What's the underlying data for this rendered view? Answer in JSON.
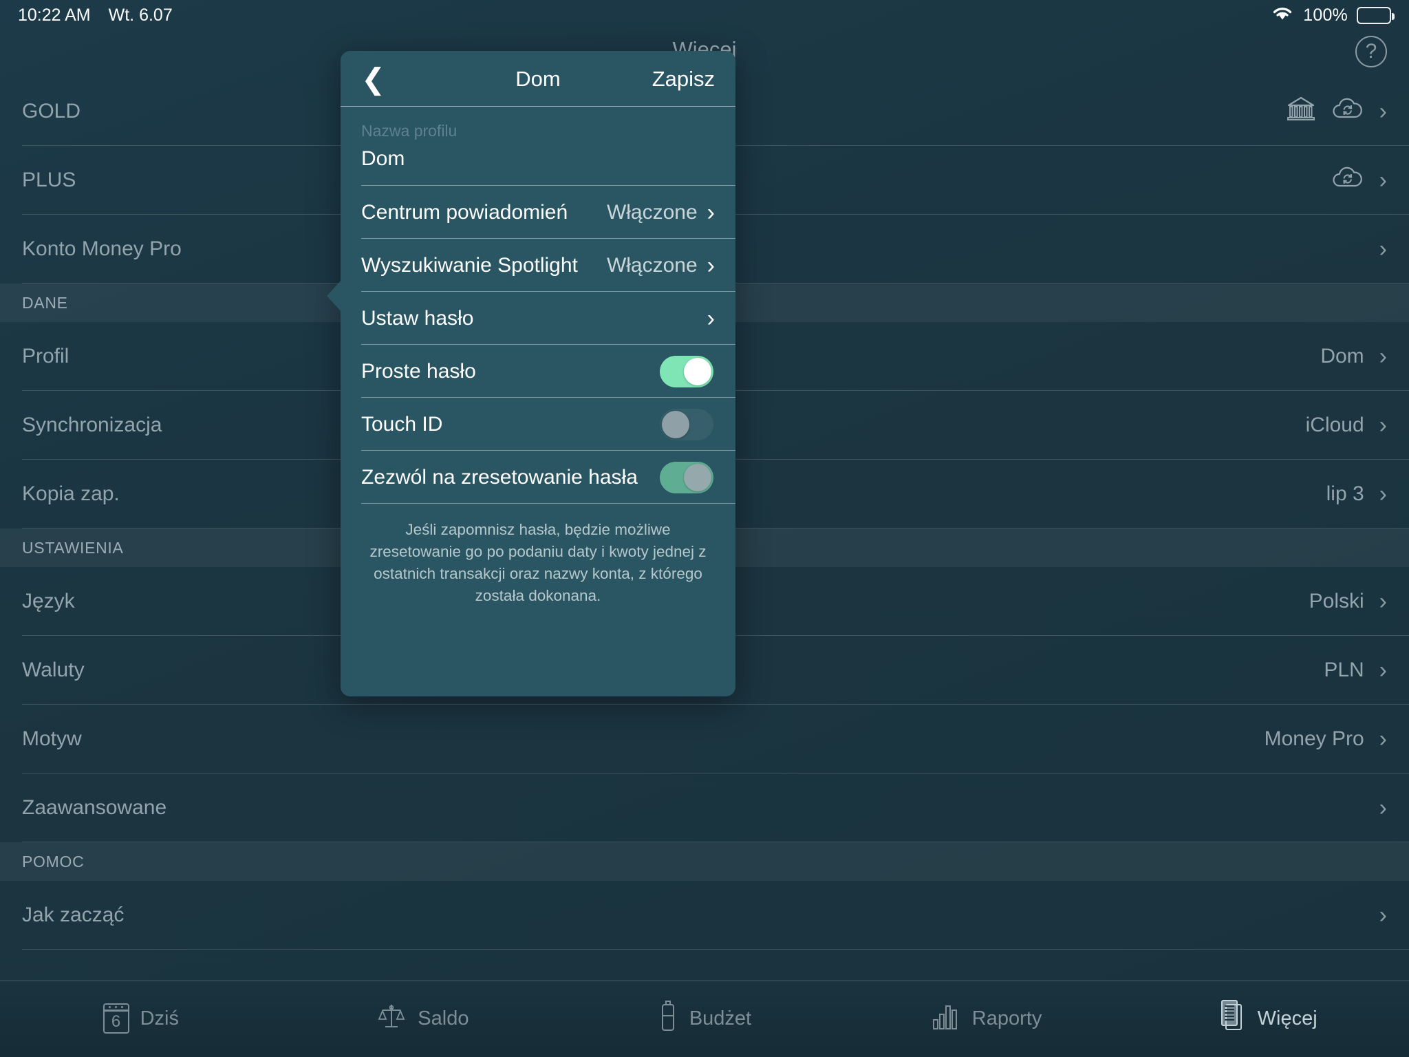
{
  "status_bar": {
    "time": "10:22 AM",
    "date": "Wt. 6.07",
    "battery_percent": "100%",
    "wifi_icon": "wifi-icon",
    "battery_icon": "battery-full-icon"
  },
  "header": {
    "title": "Więcej",
    "help_icon": "question-circle-icon",
    "help_label": "?"
  },
  "background_list": {
    "rows": [
      {
        "type": "item",
        "label": "GOLD",
        "value": "",
        "icons": [
          "bank-icon",
          "cloud-sync-icon"
        ],
        "chevron": "›"
      },
      {
        "type": "item",
        "label": "PLUS",
        "value": "",
        "icons": [
          "cloud-sync-icon"
        ],
        "chevron": "›"
      },
      {
        "type": "item",
        "label": "Konto Money Pro",
        "value": "",
        "icons": [],
        "chevron": "›"
      },
      {
        "type": "section",
        "label": "DANE"
      },
      {
        "type": "item",
        "label": "Profil",
        "value": "Dom",
        "icons": [],
        "chevron": "›"
      },
      {
        "type": "item",
        "label": "Synchronizacja",
        "value": "iCloud",
        "icons": [],
        "chevron": "›"
      },
      {
        "type": "item",
        "label": "Kopia zap.",
        "value": "lip 3",
        "icons": [],
        "chevron": "›"
      },
      {
        "type": "section",
        "label": "USTAWIENIA"
      },
      {
        "type": "item",
        "label": "Język",
        "value": "Polski",
        "icons": [],
        "chevron": "›"
      },
      {
        "type": "item",
        "label": "Waluty",
        "value": "PLN",
        "icons": [],
        "chevron": "›"
      },
      {
        "type": "item",
        "label": "Motyw",
        "value": "Money Pro",
        "icons": [],
        "chevron": "›"
      },
      {
        "type": "item",
        "label": "Zaawansowane",
        "value": "",
        "icons": [],
        "chevron": "›"
      },
      {
        "type": "section",
        "label": "POMOC"
      },
      {
        "type": "item",
        "label": "Jak zacząć",
        "value": "",
        "icons": [],
        "chevron": "›"
      }
    ]
  },
  "popover": {
    "back_icon": "chevron-left-icon",
    "back_glyph": "❮",
    "title": "Dom",
    "save_label": "Zapisz",
    "profile_field": {
      "label": "Nazwa profilu",
      "value": "Dom"
    },
    "rows": [
      {
        "label": "Centrum powiadomień",
        "value": "Włączone",
        "chevron": "›",
        "kind": "nav"
      },
      {
        "label": "Wyszukiwanie Spotlight",
        "value": "Włączone",
        "chevron": "›",
        "kind": "nav"
      },
      {
        "label": "Ustaw hasło",
        "value": "",
        "chevron": "›",
        "kind": "nav"
      },
      {
        "label": "Proste hasło",
        "value": "",
        "chevron": "",
        "kind": "toggle",
        "state": "on"
      },
      {
        "label": "Touch ID",
        "value": "",
        "chevron": "",
        "kind": "toggle",
        "state": "off"
      },
      {
        "label": "Zezwól na zresetowanie hasła",
        "value": "",
        "chevron": "",
        "kind": "toggle",
        "state": "on-dim"
      }
    ],
    "footnote": "Jeśli zapomnisz hasła, będzie możliwe zresetowanie go po podaniu daty i kwoty jednej z ostatnich transakcji oraz nazwy konta, z którego została dokonana."
  },
  "tabbar": {
    "tabs": [
      {
        "label": "Dziś",
        "icon": "calendar-icon",
        "badge": "6",
        "active": false
      },
      {
        "label": "Saldo",
        "icon": "scales-icon",
        "active": false
      },
      {
        "label": "Budżet",
        "icon": "budget-bottle-icon",
        "active": false
      },
      {
        "label": "Raporty",
        "icon": "bar-chart-icon",
        "active": false
      },
      {
        "label": "Więcej",
        "icon": "documents-icon",
        "active": true
      }
    ]
  },
  "colors": {
    "popover_bg": "#2a5562",
    "page_bg": "#1b3541",
    "toggle_on": "#7fe5b4",
    "toggle_on_dim": "#5fae93",
    "toggle_off_knob": "#8fa1a6",
    "text_primary": "#ffffff",
    "text_muted": "#93a4ac"
  }
}
